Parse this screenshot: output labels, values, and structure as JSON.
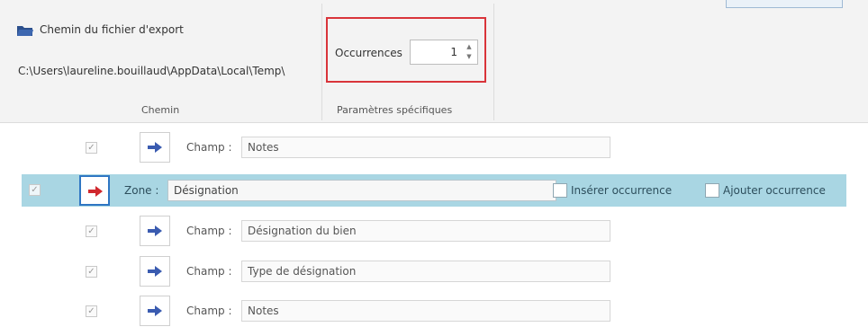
{
  "ribbon": {
    "path": {
      "label": "Chemin du fichier d'export",
      "value": "C:\\Users\\laureline.bouillaud\\AppData\\Local\\Temp\\",
      "group_label": "Chemin"
    },
    "specific": {
      "occurrences_label": "Occurrences",
      "occurrences_value": "1",
      "group_label": "Paramètres spécifiques"
    }
  },
  "rows": [
    {
      "type_label": "Champ :",
      "value": "Notes",
      "checked": true,
      "selected": false
    },
    {
      "type_label": "Zone :",
      "value": "Désignation",
      "checked": true,
      "selected": true,
      "insert_label": "Insérer occurrence",
      "add_label": "Ajouter occurrence"
    },
    {
      "type_label": "Champ :",
      "value": "Désignation du bien",
      "checked": true,
      "selected": false
    },
    {
      "type_label": "Champ :",
      "value": "Type de désignation",
      "checked": true,
      "selected": false
    },
    {
      "type_label": "Champ :",
      "value": "Notes",
      "checked": true,
      "selected": false
    }
  ],
  "colors": {
    "selection": "#a9d6e3",
    "highlight_box": "#d9343a",
    "arrow_blue": "#3a5bb0",
    "arrow_red": "#d0282e"
  }
}
